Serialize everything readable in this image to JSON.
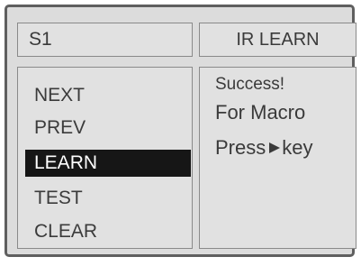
{
  "header": {
    "slot": "S1",
    "mode": "IR LEARN"
  },
  "menu": {
    "items": [
      {
        "label": "NEXT",
        "selected": false
      },
      {
        "label": "PREV",
        "selected": false
      },
      {
        "label": "LEARN",
        "selected": true
      },
      {
        "label": "TEST",
        "selected": false
      },
      {
        "label": "CLEAR",
        "selected": false
      }
    ]
  },
  "message": {
    "status": "Success!",
    "line2": "For Macro",
    "line3_prefix": "Press",
    "line3_icon": "play-arrow-icon",
    "line3_suffix": "key"
  },
  "colors": {
    "screen_bg": "#dcdcdc",
    "panel_bg": "#e1e1e1",
    "text": "#3a3a3a",
    "highlight_bg": "#161616",
    "highlight_text": "#ffffff"
  }
}
